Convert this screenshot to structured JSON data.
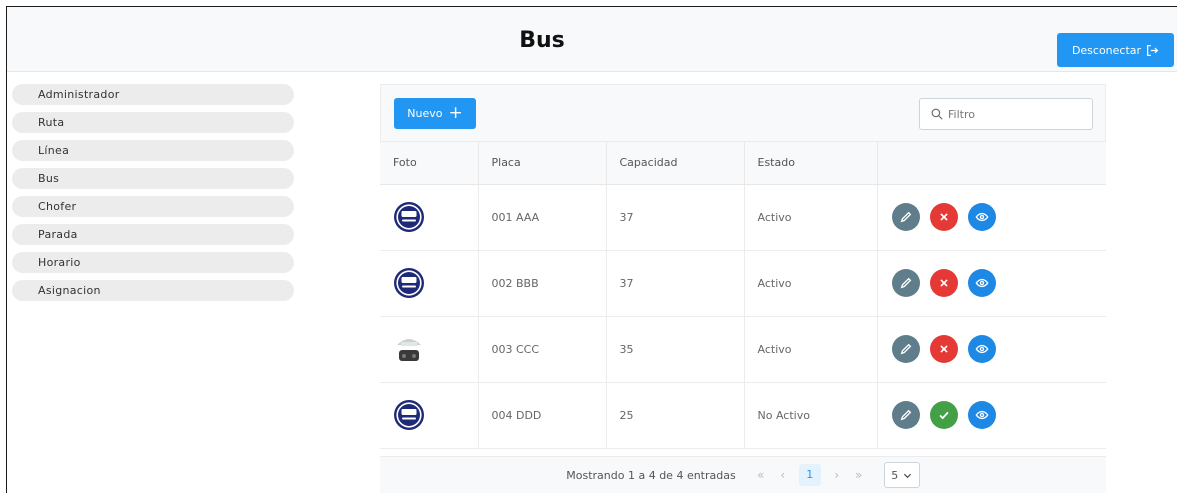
{
  "header": {
    "title": "Bus",
    "logout_label": "Desconectar"
  },
  "sidebar": {
    "items": [
      "Administrador",
      "Ruta",
      "Línea",
      "Bus",
      "Chofer",
      "Parada",
      "Horario",
      "Asignacion"
    ]
  },
  "toolbar": {
    "new_label": "Nuevo",
    "search_placeholder": "Filtro"
  },
  "table": {
    "columns": [
      "Foto",
      "Placa",
      "Capacidad",
      "Estado",
      ""
    ],
    "rows": [
      {
        "foto": "bus-icon",
        "placa": "001 AAA",
        "capacidad": "37",
        "estado": "Activo",
        "toggle": "deactivate"
      },
      {
        "foto": "bus-icon",
        "placa": "002 BBB",
        "capacidad": "37",
        "estado": "Activo",
        "toggle": "deactivate"
      },
      {
        "foto": "photo-thumbnail",
        "placa": "003 CCC",
        "capacidad": "35",
        "estado": "Activo",
        "toggle": "deactivate"
      },
      {
        "foto": "bus-icon",
        "placa": "004 DDD",
        "capacidad": "25",
        "estado": "No Activo",
        "toggle": "activate"
      }
    ]
  },
  "pagination": {
    "info": "Mostrando 1 a 4 de 4 entradas",
    "first": "«",
    "prev": "‹",
    "current_page": "1",
    "next": "›",
    "last": "»",
    "rows_per_page": "5"
  },
  "colors": {
    "primary": "#2196f3",
    "edit": "#607d8b",
    "delete": "#e53935",
    "activate": "#43a047",
    "view": "#1e88e5"
  }
}
